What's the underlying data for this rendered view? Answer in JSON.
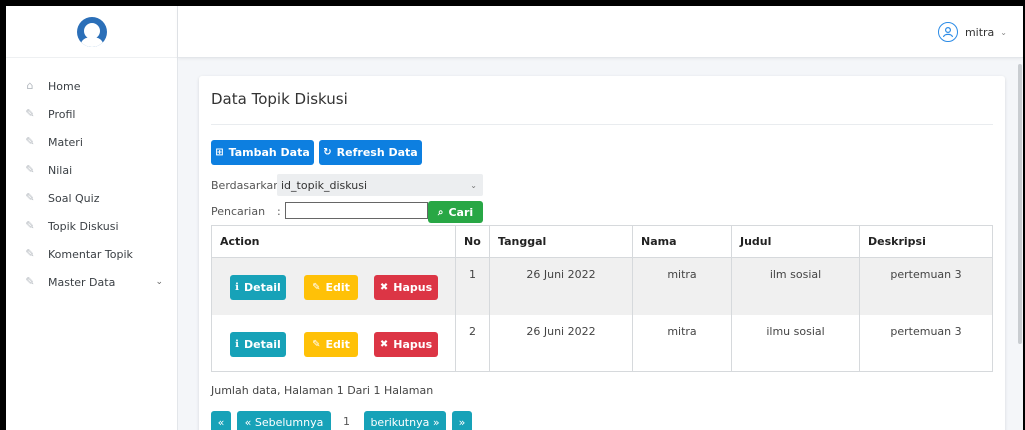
{
  "sidebar": {
    "items": [
      {
        "label": "Home",
        "icon": "home-icon"
      },
      {
        "label": "Profil",
        "icon": "edit-icon"
      },
      {
        "label": "Materi",
        "icon": "edit-icon"
      },
      {
        "label": "Nilai",
        "icon": "edit-icon"
      },
      {
        "label": "Soal Quiz",
        "icon": "edit-icon"
      },
      {
        "label": "Topik Diskusi",
        "icon": "edit-icon"
      },
      {
        "label": "Komentar Topik",
        "icon": "edit-icon"
      },
      {
        "label": "Master Data",
        "icon": "edit-icon"
      }
    ]
  },
  "topbar": {
    "user": "mitra"
  },
  "card": {
    "title": "Data Topik Diskusi",
    "add_label": "Tambah Data",
    "refresh_label": "Refresh Data",
    "filter_label": "Berdasarkan:",
    "filter_value": "id_topik_diskusi",
    "search_label": "Pencarian",
    "search_colon": ":",
    "search_value": "",
    "search_button": "Cari"
  },
  "table": {
    "headers": [
      "Action",
      "No",
      "Tanggal",
      "Nama",
      "Judul",
      "Deskripsi"
    ],
    "action_labels": {
      "detail": "Detail",
      "edit": "Edit",
      "delete": "Hapus"
    },
    "rows": [
      {
        "no": "1",
        "tanggal": "26 Juni 2022",
        "nama": "mitra",
        "judul": "ilm sosial",
        "deskripsi": "pertemuan 3"
      },
      {
        "no": "2",
        "tanggal": "26 Juni 2022",
        "nama": "mitra",
        "judul": "ilmu sosial",
        "deskripsi": "pertemuan 3"
      }
    ]
  },
  "summary": "Jumlah data, Halaman 1 Dari 1 Halaman",
  "pagination": {
    "first": "«",
    "prev": "« Sebelumnya",
    "current": "1",
    "next": "berikutnya »",
    "last": "»"
  },
  "colors": {
    "primary": "#0d7fe0",
    "info": "#17a2b8",
    "warning": "#ffc107",
    "danger": "#dc3545",
    "success": "#28a745",
    "brand": "#2b6fb8"
  }
}
